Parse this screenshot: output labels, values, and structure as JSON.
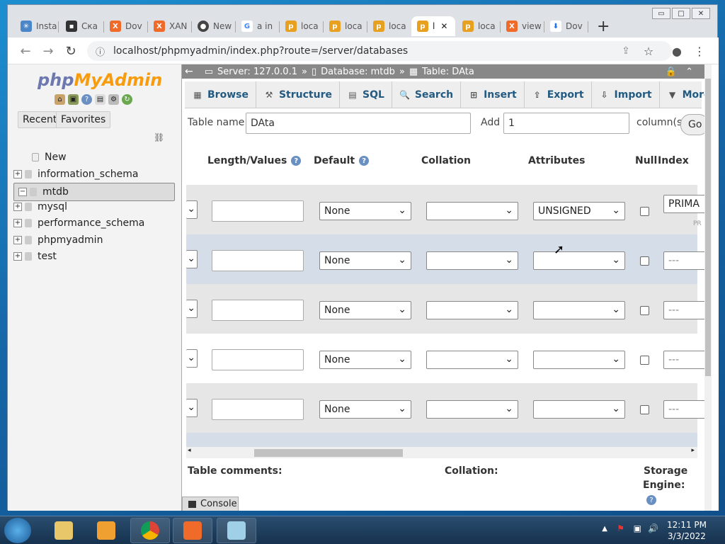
{
  "browser": {
    "tabs": [
      {
        "label": "Insta",
        "icon": "asterisk-icon",
        "color": "#4a86c8"
      },
      {
        "label": "Ска",
        "icon": "terminal-icon",
        "color": "#333333"
      },
      {
        "label": "Dov",
        "icon": "xampp-icon",
        "color": "#f06a2a"
      },
      {
        "label": "XAN",
        "icon": "xampp-icon",
        "color": "#f06a2a"
      },
      {
        "label": "New",
        "icon": "github-icon",
        "color": "#444444"
      },
      {
        "label": "a in",
        "icon": "google-icon",
        "color": "#4285f4"
      },
      {
        "label": "loca",
        "icon": "pma-icon",
        "color": "#e8a020"
      },
      {
        "label": "loca",
        "icon": "pma-icon",
        "color": "#e8a020"
      },
      {
        "label": "loca",
        "icon": "pma-icon",
        "color": "#e8a020"
      },
      {
        "label": "l",
        "icon": "pma-icon",
        "color": "#e8a020"
      },
      {
        "label": "loca",
        "icon": "pma-icon",
        "color": "#e8a020"
      },
      {
        "label": "view",
        "icon": "xampp-icon",
        "color": "#f06a2a"
      },
      {
        "label": "Dov",
        "icon": "download-icon",
        "color": "#1a73e8"
      }
    ],
    "url": "localhost/phpmyadmin/index.php?route=/server/databases",
    "new_tab": "+",
    "close_tab": "✕"
  },
  "pma": {
    "logo_a": "php",
    "logo_b": "MyAdmin",
    "recent": "Recent",
    "favorites": "Favorites",
    "tree": [
      {
        "label": "New",
        "pm": ""
      },
      {
        "label": "information_schema",
        "pm": "+"
      },
      {
        "label": "mtdb",
        "pm": "−"
      },
      {
        "label": "mysql",
        "pm": "+"
      },
      {
        "label": "performance_schema",
        "pm": "+"
      },
      {
        "label": "phpmyadmin",
        "pm": "+"
      },
      {
        "label": "test",
        "pm": "+"
      }
    ],
    "breadcrumb": {
      "server": "Server: 127.0.0.1",
      "sep": "»",
      "database": "Database: mtdb",
      "table": "Table: DAta"
    },
    "tabs": [
      "Browse",
      "Structure",
      "SQL",
      "Search",
      "Insert",
      "Export",
      "Import",
      "More"
    ],
    "table_name_label": "Table name:",
    "table_name": "DAta",
    "add_label": "Add",
    "add_value": "1",
    "columns_label": "column(s)",
    "go": "Go",
    "headers": {
      "length": "Length/Values",
      "default": "Default",
      "collation": "Collation",
      "attributes": "Attributes",
      "null": "Null",
      "index": "Index"
    },
    "rows": [
      {
        "default": "None",
        "collation": "",
        "attributes": "UNSIGNED",
        "index": "PRIMA",
        "sub": "PR"
      },
      {
        "default": "None",
        "collation": "",
        "attributes": "",
        "index": "---"
      },
      {
        "default": "None",
        "collation": "",
        "attributes": "",
        "index": "---"
      },
      {
        "default": "None",
        "collation": "",
        "attributes": "",
        "index": "---"
      },
      {
        "default": "None",
        "collation": "",
        "attributes": "",
        "index": "---"
      }
    ],
    "table_comments": "Table comments:",
    "collation_label": "Collation:",
    "storage1": "Storage",
    "storage2": "Engine:",
    "console": "Console"
  },
  "taskbar": {
    "time": "12:11 PM",
    "date": "3/3/2022"
  }
}
